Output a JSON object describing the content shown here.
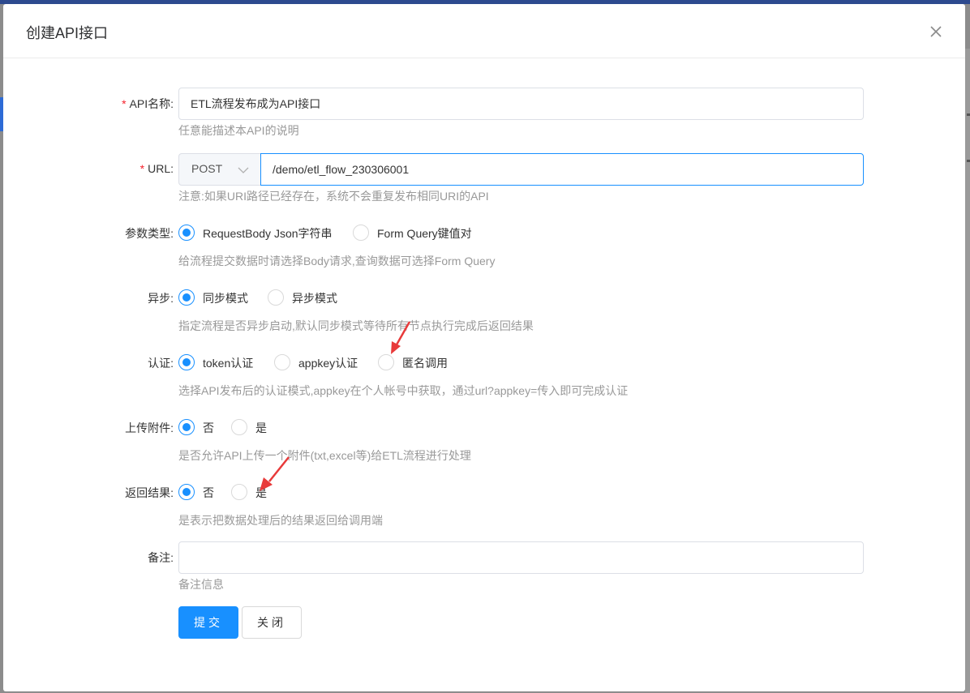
{
  "dialog": {
    "title": "创建API接口"
  },
  "form": {
    "api_name": {
      "label": "API名称:",
      "required": true,
      "value": "ETL流程发布成为API接口",
      "hint": "任意能描述本API的说明"
    },
    "url": {
      "label": "URL:",
      "required": true,
      "method": "POST",
      "value": "/demo/etl_flow_230306001",
      "hint": "注意:如果URI路径已经存在，系统不会重复发布相同URI的API"
    },
    "param_type": {
      "label": "参数类型:",
      "options": [
        "RequestBody Json字符串",
        "Form Query键值对"
      ],
      "selected": 0,
      "hint": "给流程提交数据时请选择Body请求,查询数据可选择Form Query"
    },
    "async": {
      "label": "异步:",
      "options": [
        "同步模式",
        "异步模式"
      ],
      "selected": 0,
      "hint": "指定流程是否异步启动,默认同步模式等待所有节点执行完成后返回结果"
    },
    "auth": {
      "label": "认证:",
      "options": [
        "token认证",
        "appkey认证",
        "匿名调用"
      ],
      "selected": 0,
      "hint": "选择API发布后的认证模式,appkey在个人帐号中获取，通过url?appkey=传入即可完成认证"
    },
    "upload": {
      "label": "上传附件:",
      "options": [
        "否",
        "是"
      ],
      "selected": 0,
      "hint": "是否允许API上传一个附件(txt,excel等)给ETL流程进行处理"
    },
    "return_result": {
      "label": "返回结果:",
      "options": [
        "否",
        "是"
      ],
      "selected": 0,
      "hint": "是表示把数据处理后的结果返回给调用端"
    },
    "remark": {
      "label": "备注:",
      "value": "",
      "hint": "备注信息"
    }
  },
  "buttons": {
    "submit": "提交",
    "close": "关闭"
  },
  "colors": {
    "primary": "#1890ff",
    "required": "#f5222d",
    "hint": "#999999",
    "annotation_arrow": "#e83a3a"
  }
}
